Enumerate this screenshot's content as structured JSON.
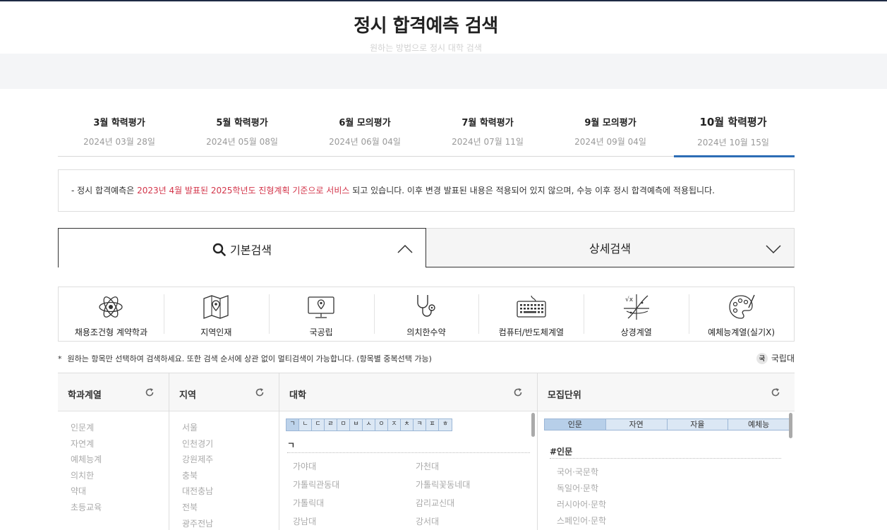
{
  "header": {
    "title": "정시 합격예측 검색",
    "subtitle": "원하는 방법으로 정시 대학 검색"
  },
  "exam_tabs": [
    {
      "name": "3월 학력평가",
      "date": "2024년 03월 28일",
      "active": false
    },
    {
      "name": "5월 학력평가",
      "date": "2024년 05월 08일",
      "active": false
    },
    {
      "name": "6월 모의평가",
      "date": "2024년 06월 04일",
      "active": false
    },
    {
      "name": "7월 학력평가",
      "date": "2024년 07월 11일",
      "active": false
    },
    {
      "name": "9월 모의평가",
      "date": "2024년 09월 04일",
      "active": false
    },
    {
      "name": "10월 학력평가",
      "date": "2024년 10월 15일",
      "active": true
    }
  ],
  "notice": {
    "prefix": "-  정시 합격예측은 ",
    "highlight": "2023년 4월 발표된 2025학년도 진형계획 기준으로 서비스",
    "suffix": " 되고 있습니다. 이후 변경 발표된 내용은 적용되어 있지 않으며, 수능 이후 정시 합격예측에 적용됩니다."
  },
  "search_tabs": {
    "basic": "기본검색",
    "detail": "상세검색"
  },
  "categories": [
    {
      "label": "채용조건형 계약학과",
      "icon": "atom-icon"
    },
    {
      "label": "지역인재",
      "icon": "map-pin-icon"
    },
    {
      "label": "국공립",
      "icon": "monitor-location-icon"
    },
    {
      "label": "의치한수약",
      "icon": "stethoscope-icon"
    },
    {
      "label": "컴퓨터/반도체계열",
      "icon": "keyboard-icon"
    },
    {
      "label": "상경계열",
      "icon": "math-graph-icon"
    },
    {
      "label": "예체능계열(실기X)",
      "icon": "palette-icon"
    }
  ],
  "guide": {
    "star": "*",
    "text": "원하는 항목만 선택하여 검색하세요. 또한 검색 순서에 상관 없이 멀티검색이 가능합니다. (항목별 중복선택 가능)",
    "national_badge": "국",
    "national_label": "국립대"
  },
  "panels": {
    "field": {
      "title": "학과계열",
      "items": [
        "인문계",
        "자연계",
        "예체능계",
        "의치한",
        "약대",
        "초등교육"
      ]
    },
    "region": {
      "title": "지역",
      "items": [
        "서울",
        "인천경기",
        "강원제주",
        "충북",
        "대전충남",
        "전북",
        "광주전남"
      ]
    },
    "university": {
      "title": "대학",
      "jamo": [
        "ㄱ",
        "ㄴ",
        "ㄷ",
        "ㄹ",
        "ㅁ",
        "ㅂ",
        "ㅅ",
        "ㅇ",
        "ㅈ",
        "ㅊ",
        "ㅋ",
        "ㅍ",
        "ㅎ"
      ],
      "section": "ㄱ",
      "items": [
        "가야대",
        "가천대",
        "가톨릭관동대",
        "가톨릭꽃동네대",
        "가톨릭대",
        "감리교신대",
        "강남대",
        "강서대"
      ]
    },
    "unit": {
      "title": "모집단위",
      "tabs": [
        "인문",
        "자연",
        "자율",
        "예체능"
      ],
      "section": "#인문",
      "items": [
        "국어·국문학",
        "독일어·문학",
        "러시아어·문학",
        "스페인어·문학"
      ]
    }
  },
  "colors": {
    "accent": "#2d6db5",
    "notice_highlight": "#d3354a",
    "top_border": "#1e2a44"
  }
}
